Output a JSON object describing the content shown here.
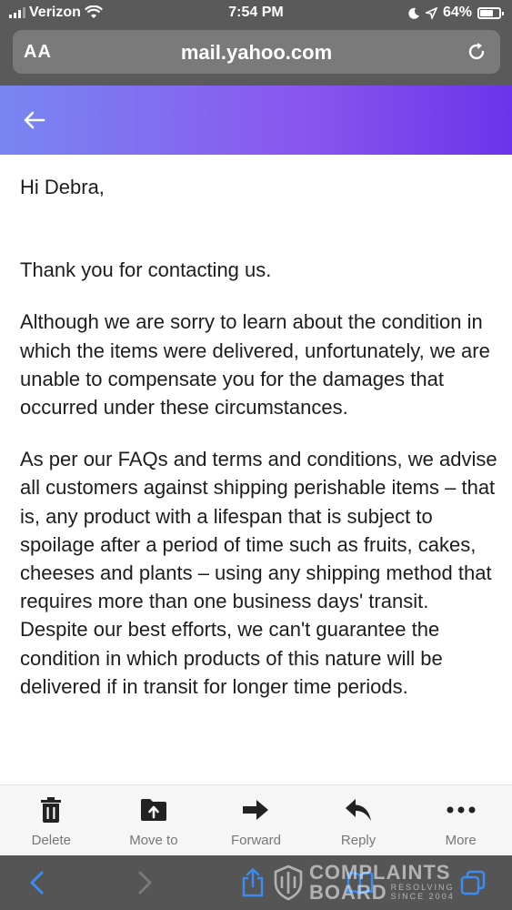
{
  "status_bar": {
    "carrier": "Verizon",
    "time": "7:54 PM",
    "battery": "64%"
  },
  "browser": {
    "text_size_label": "AA",
    "url": "mail.yahoo.com"
  },
  "email": {
    "greeting": "Hi Debra,",
    "paragraphs": [
      "Thank you for contacting us.",
      "Although we are sorry to learn about the condition in which the items were delivered, unfortunately, we are unable to compensate you for the damages that occurred under these circumstances.",
      "As per our FAQs and terms and conditions, we advise all customers against shipping perishable items – that is, any product with a lifespan that is subject to spoilage after a period of time such as fruits, cakes, cheeses and plants – using any shipping method that requires more than one business days' transit. Despite our best efforts, we can't guarantee the condition in which products of this nature will be delivered if in transit for longer time periods."
    ]
  },
  "toolbar": {
    "items": [
      {
        "label": "Delete",
        "icon": "trash-icon"
      },
      {
        "label": "Move to",
        "icon": "folder-move-icon"
      },
      {
        "label": "Forward",
        "icon": "forward-arrow-icon"
      },
      {
        "label": "Reply",
        "icon": "reply-arrow-icon"
      },
      {
        "label": "More",
        "icon": "more-dots-icon"
      }
    ]
  },
  "watermark": {
    "line1": "COMPLAINTS",
    "line2": "BOARD",
    "tag1": "RESOLVING",
    "tag2": "SINCE 2004"
  },
  "colors": {
    "header_gradient_start": "#7887f2",
    "header_gradient_end": "#6b34ea",
    "safari_link": "#3b8cf5"
  }
}
